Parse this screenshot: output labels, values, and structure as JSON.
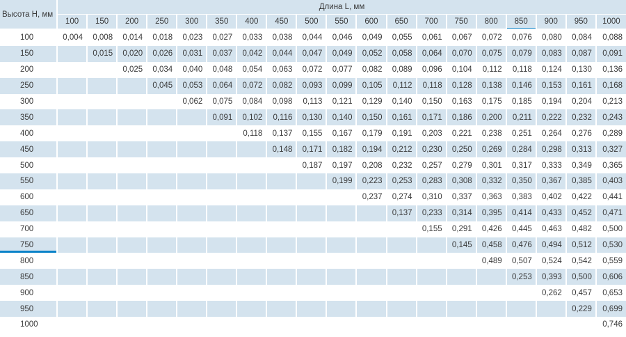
{
  "table": {
    "height_label": "Высота H, мм",
    "length_label": "Длина L, мм",
    "lengths": [
      "100",
      "150",
      "200",
      "250",
      "300",
      "350",
      "400",
      "450",
      "500",
      "550",
      "600",
      "650",
      "700",
      "750",
      "800",
      "850",
      "900",
      "950",
      "1000"
    ],
    "highlight_length": "850",
    "highlight_height": "750",
    "rows": [
      {
        "h": "100",
        "v": [
          "0,004",
          "0,008",
          "0,014",
          "0,018",
          "0,023",
          "0,027",
          "0,033",
          "0,038",
          "0,044",
          "0,046",
          "0,049",
          "0,055",
          "0,061",
          "0,067",
          "0,072",
          "0,076",
          "0,080",
          "0,084",
          "0,088"
        ]
      },
      {
        "h": "150",
        "v": [
          "",
          "0,015",
          "0,020",
          "0,026",
          "0,031",
          "0,037",
          "0,042",
          "0,044",
          "0,047",
          "0,049",
          "0,052",
          "0,058",
          "0,064",
          "0,070",
          "0,075",
          "0,079",
          "0,083",
          "0,087",
          "0,091"
        ]
      },
      {
        "h": "200",
        "v": [
          "",
          "",
          "0,025",
          "0,034",
          "0,040",
          "0,048",
          "0,054",
          "0,063",
          "0,072",
          "0,077",
          "0,082",
          "0,089",
          "0,096",
          "0,104",
          "0,112",
          "0,118",
          "0,124",
          "0,130",
          "0,136"
        ]
      },
      {
        "h": "250",
        "v": [
          "",
          "",
          "",
          "0,045",
          "0,053",
          "0,064",
          "0,072",
          "0,082",
          "0,093",
          "0,099",
          "0,105",
          "0,112",
          "0,118",
          "0,128",
          "0,138",
          "0,146",
          "0,153",
          "0,161",
          "0,168"
        ]
      },
      {
        "h": "300",
        "v": [
          "",
          "",
          "",
          "",
          "0,062",
          "0,075",
          "0,084",
          "0,098",
          "0,113",
          "0,121",
          "0,129",
          "0,140",
          "0,150",
          "0,163",
          "0,175",
          "0,185",
          "0,194",
          "0,204",
          "0,213"
        ]
      },
      {
        "h": "350",
        "v": [
          "",
          "",
          "",
          "",
          "",
          "0,091",
          "0,102",
          "0,116",
          "0,130",
          "0,140",
          "0,150",
          "0,161",
          "0,171",
          "0,186",
          "0,200",
          "0,211",
          "0,222",
          "0,232",
          "0,243"
        ]
      },
      {
        "h": "400",
        "v": [
          "",
          "",
          "",
          "",
          "",
          "",
          "0,118",
          "0,137",
          "0,155",
          "0,167",
          "0,179",
          "0,191",
          "0,203",
          "0,221",
          "0,238",
          "0,251",
          "0,264",
          "0,276",
          "0,289"
        ]
      },
      {
        "h": "450",
        "v": [
          "",
          "",
          "",
          "",
          "",
          "",
          "",
          "0,148",
          "0,171",
          "0,182",
          "0,194",
          "0,212",
          "0,230",
          "0,250",
          "0,269",
          "0,284",
          "0,298",
          "0,313",
          "0,327"
        ]
      },
      {
        "h": "500",
        "v": [
          "",
          "",
          "",
          "",
          "",
          "",
          "",
          "",
          "0,187",
          "0,197",
          "0,208",
          "0,232",
          "0,257",
          "0,279",
          "0,301",
          "0,317",
          "0,333",
          "0,349",
          "0,365"
        ]
      },
      {
        "h": "550",
        "v": [
          "",
          "",
          "",
          "",
          "",
          "",
          "",
          "",
          "",
          "0,199",
          "0,223",
          "0,253",
          "0,283",
          "0,308",
          "0,332",
          "0,350",
          "0,367",
          "0,385",
          "0,403"
        ]
      },
      {
        "h": "600",
        "v": [
          "",
          "",
          "",
          "",
          "",
          "",
          "",
          "",
          "",
          "",
          "0,237",
          "0,274",
          "0,310",
          "0,337",
          "0,363",
          "0,383",
          "0,402",
          "0,422",
          "0,441"
        ]
      },
      {
        "h": "650",
        "v": [
          "",
          "",
          "",
          "",
          "",
          "",
          "",
          "",
          "",
          "",
          "",
          "0,137",
          "0,233",
          "0,314",
          "0,395",
          "0,414",
          "0,433",
          "0,452",
          "0,471"
        ]
      },
      {
        "h": "700",
        "v": [
          "",
          "",
          "",
          "",
          "",
          "",
          "",
          "",
          "",
          "",
          "",
          "",
          "0,155",
          "0,291",
          "0,426",
          "0,445",
          "0,463",
          "0,482",
          "0,500"
        ]
      },
      {
        "h": "750",
        "v": [
          "",
          "",
          "",
          "",
          "",
          "",
          "",
          "",
          "",
          "",
          "",
          "",
          "",
          "0,145",
          "0,458",
          "0,476",
          "0,494",
          "0,512",
          "0,530"
        ]
      },
      {
        "h": "800",
        "v": [
          "",
          "",
          "",
          "",
          "",
          "",
          "",
          "",
          "",
          "",
          "",
          "",
          "",
          "",
          "0,489",
          "0,507",
          "0,524",
          "0,542",
          "0,559"
        ]
      },
      {
        "h": "850",
        "v": [
          "",
          "",
          "",
          "",
          "",
          "",
          "",
          "",
          "",
          "",
          "",
          "",
          "",
          "",
          "",
          "0,253",
          "0,393",
          "0,500",
          "0,606"
        ]
      },
      {
        "h": "900",
        "v": [
          "",
          "",
          "",
          "",
          "",
          "",
          "",
          "",
          "",
          "",
          "",
          "",
          "",
          "",
          "",
          "",
          "0,262",
          "0,457",
          "0,653"
        ]
      },
      {
        "h": "950",
        "v": [
          "",
          "",
          "",
          "",
          "",
          "",
          "",
          "",
          "",
          "",
          "",
          "",
          "",
          "",
          "",
          "",
          "",
          "0,229",
          "0,699"
        ]
      },
      {
        "h": "1000",
        "v": [
          "",
          "",
          "",
          "",
          "",
          "",
          "",
          "",
          "",
          "",
          "",
          "",
          "",
          "",
          "",
          "",
          "",
          "",
          "0,746"
        ]
      }
    ]
  },
  "colors": {
    "band": "#d4e3ee",
    "accent": "#0a82c8",
    "text": "#3a3a3a"
  }
}
